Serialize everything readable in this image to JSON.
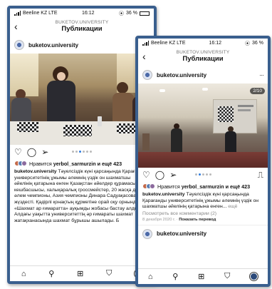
{
  "left": {
    "status": {
      "carrier": "Beeline KZ  LTE",
      "time": "16:12",
      "battery": "36 %"
    },
    "nav": {
      "subtitle": "BUKETOV.UNIVERSITY",
      "title": "Публикации"
    },
    "post": {
      "username": "buketov.university",
      "likes_prefix": "Нравится ",
      "likes_user": "yerbol_sarmurzin",
      "likes_suffix": " и ещё 423",
      "caption_user": "buketov.university",
      "caption_text": " Тәуелсіздік күні қарсаңында Қарағанды университетінің ұжымы әлемнің үздік он шахматшы әйелінің қатарына енген Қазақстан әйелдер құрамасының кешбасшысы, халықаралық гроссмейстер, 20 жасқа дейінгі әлем чемпионы, Азия чемпионы Динара Садуақасовамен жүздесті. Қадірлі қонақтың құрметіне орай оқу орнында «Шахмат ар ғимаратта» ауқымды жобасы бастау алды. Алдағы уақытта университеттің әр ғимараты шахмат жатақханасында шахмат бұрышы ашылады. Б"
    },
    "icons": {
      "back": "back-chevron-icon",
      "like": "heart-icon",
      "comment": "comment-icon",
      "share": "send-icon",
      "bookmark": "bookmark-icon"
    },
    "tabs": [
      "home-icon",
      "search-icon",
      "add-post-icon",
      "shop-icon",
      "profile-icon"
    ]
  },
  "right": {
    "status": {
      "carrier": "Beeline KZ  LTE",
      "time": "16:12",
      "battery": "36 %"
    },
    "nav": {
      "subtitle": "BUKETOV.UNIVERSITY",
      "title": "Публикации"
    },
    "post": {
      "username": "buketov.university",
      "counter": "2/10",
      "likes_prefix": "Нравится ",
      "likes_user": "yerbol_sarmurzin",
      "likes_suffix": " и ещё 423",
      "caption_user": "buketov.university",
      "caption_text": " Тәуелсіздік күні қарсаңында Қарағанды университетінің ұжымы әлемнің үздік он шахматшы әйелінің қатарына енген...",
      "caption_more": " ещё",
      "view_comments": "Посмотреть все комментарии (2)",
      "date": "8 декабря 2020 г. · ",
      "translate": "Показать перевод"
    },
    "next_post": {
      "username": "buketov.university"
    }
  },
  "colors": {
    "frame": "#3a5f8e",
    "active_dot": "#2f7de1",
    "muted": "#888888"
  }
}
